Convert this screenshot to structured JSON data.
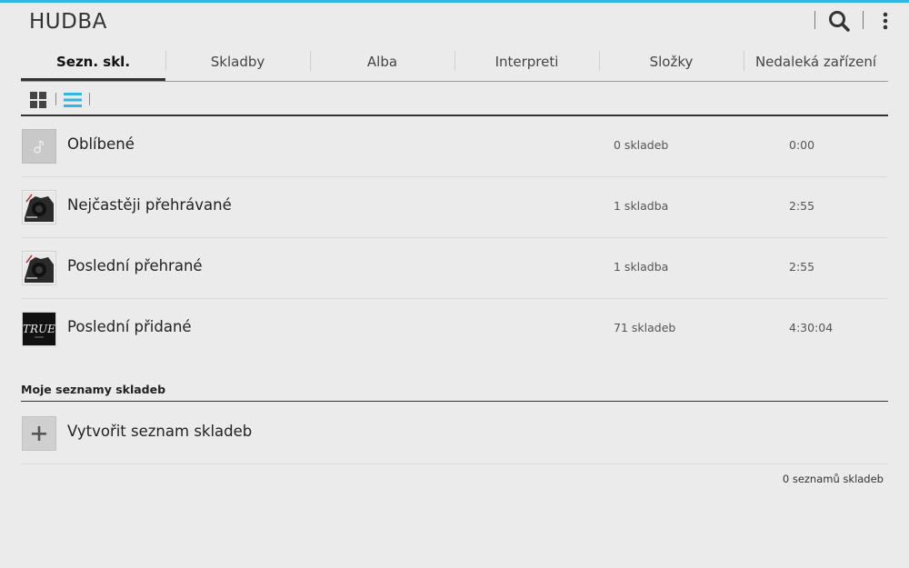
{
  "app": {
    "title": "HUDBA"
  },
  "actions": {
    "search_icon": "search-icon",
    "overflow_icon": "overflow-menu-icon"
  },
  "tabs": [
    {
      "label": "Sezn. skl.",
      "active": true
    },
    {
      "label": "Skladby",
      "active": false
    },
    {
      "label": "Alba",
      "active": false
    },
    {
      "label": "Interpreti",
      "active": false
    },
    {
      "label": "Složky",
      "active": false
    },
    {
      "label": "Nedaleká zařízení",
      "active": false
    }
  ],
  "view_toggles": {
    "grid_icon": "grid-view-icon",
    "list_icon": "list-view-icon",
    "active": "list"
  },
  "auto_playlists": [
    {
      "title": "Oblíbené",
      "count": "0 skladeb",
      "duration": "0:00",
      "art": "music-note-icon"
    },
    {
      "title": "Nejčastěji přehrávané",
      "count": "1 skladba",
      "duration": "2:55",
      "art": "album-art"
    },
    {
      "title": "Poslední přehrané",
      "count": "1 skladba",
      "duration": "2:55",
      "art": "album-art"
    },
    {
      "title": "Poslední přidané",
      "count": "71 skladeb",
      "duration": "4:30:04",
      "art": "album-art",
      "art_text": "TRUE"
    }
  ],
  "my_playlists": {
    "header": "Moje seznamy skladeb",
    "create_label": "Vytvořit seznam skladeb",
    "footer": "0 seznamů skladeb"
  },
  "colors": {
    "accent": "#33b5e5",
    "background": "#ebebeb",
    "text": "#222222"
  }
}
